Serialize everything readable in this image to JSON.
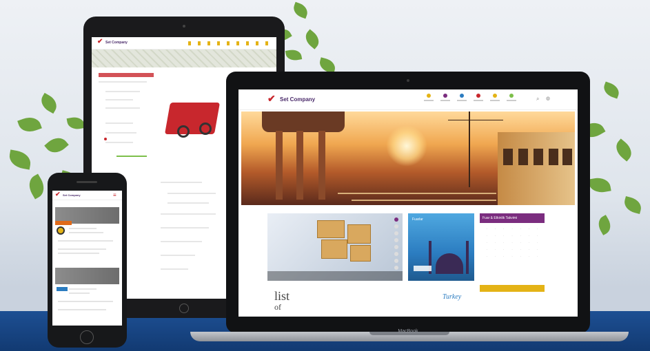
{
  "laptop": {
    "brand": "Set Company",
    "base_label": "MacBook",
    "nav": [
      "",
      "",
      "",
      "",
      "",
      ""
    ],
    "calendar": {
      "title": "Fuar & Etkinlik Takvimi",
      "days": [
        "",
        "",
        "",
        "",
        "",
        "",
        "",
        "",
        "",
        "",
        "",
        "",
        "",
        "",
        "",
        "",
        "",
        "",
        "",
        "",
        "",
        "",
        "",
        "",
        "",
        "",
        "",
        ""
      ]
    },
    "card_b_title": "Fuarlar",
    "list_text": [
      "list",
      "of"
    ],
    "turkey_text": "Turkey"
  },
  "tablet": {
    "brand": "Set Company"
  },
  "phone": {
    "brand": "Set Company"
  },
  "colors": {
    "brand_red": "#c8272d",
    "brand_purple": "#7b2d7f",
    "accent_yellow": "#e4b316",
    "floor_blue": "#1d4f93"
  }
}
